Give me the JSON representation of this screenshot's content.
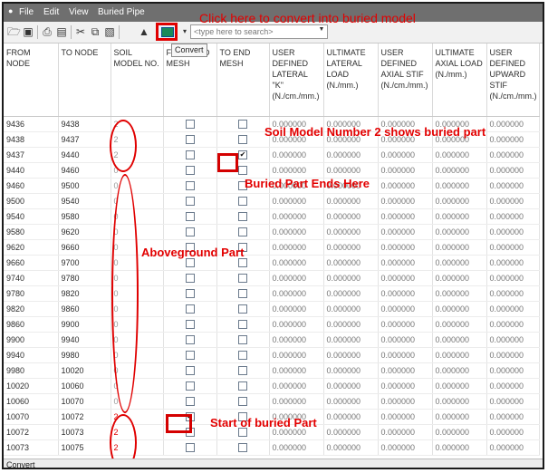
{
  "menu": {
    "items": [
      "File",
      "Edit",
      "View",
      "Buried Pipe"
    ]
  },
  "toolbar": {
    "icons": [
      "folder-open-icon",
      "save-icon",
      "print-icon",
      "print-preview-icon",
      "cut-icon",
      "copy-icon",
      "paste-icon",
      "tree-icon",
      "convert-icon"
    ],
    "search_placeholder": "<type here to search>",
    "tooltip": "Convert"
  },
  "annotations": {
    "top": "Click here to convert into buried model",
    "soil_model": "Soil Model Number 2 shows buried part",
    "buried_end": "Buried Part Ends Here",
    "aboveground": "Aboveground Part",
    "buried_start": "Start of buried Part"
  },
  "table": {
    "headers": [
      "FROM NODE",
      "TO NODE",
      "SOIL MODEL NO.",
      "FROM END MESH",
      "TO END MESH",
      "USER DEFINED LATERAL \"K\" (N./cm./mm.)",
      "ULTIMATE LATERAL LOAD (N./mm.)",
      "USER DEFINED AXIAL STIF (N./cm./mm.)",
      "ULTIMATE AXIAL LOAD (N./mm.)",
      "USER DEFINED UPWARD STIF (N./cm./mm.)"
    ],
    "rows": [
      {
        "from": "9436",
        "to": "9438",
        "soil": "2",
        "from_mesh": false,
        "to_mesh": false,
        "v": [
          "0.000000",
          "0.000000",
          "0.000000",
          "0.000000",
          "0.000000"
        ]
      },
      {
        "from": "9438",
        "to": "9437",
        "soil": "2",
        "from_mesh": false,
        "to_mesh": false,
        "v": [
          "0.000000",
          "0.000000",
          "0.000000",
          "0.000000",
          "0.000000"
        ]
      },
      {
        "from": "9437",
        "to": "9440",
        "soil": "2",
        "from_mesh": false,
        "to_mesh": true,
        "v": [
          "0.000000",
          "0.000000",
          "0.000000",
          "0.000000",
          "0.000000"
        ]
      },
      {
        "from": "9440",
        "to": "9460",
        "soil": "0",
        "from_mesh": false,
        "to_mesh": false,
        "v": [
          "0.000000",
          "0.000000",
          "0.000000",
          "0.000000",
          "0.000000"
        ]
      },
      {
        "from": "9460",
        "to": "9500",
        "soil": "0",
        "from_mesh": false,
        "to_mesh": false,
        "v": [
          "0.000000",
          "0.000000",
          "0.000000",
          "0.000000",
          "0.000000"
        ]
      },
      {
        "from": "9500",
        "to": "9540",
        "soil": "0",
        "from_mesh": false,
        "to_mesh": false,
        "v": [
          "0.000000",
          "0.000000",
          "0.000000",
          "0.000000",
          "0.000000"
        ]
      },
      {
        "from": "9540",
        "to": "9580",
        "soil": "0",
        "from_mesh": false,
        "to_mesh": false,
        "v": [
          "0.000000",
          "0.000000",
          "0.000000",
          "0.000000",
          "0.000000"
        ]
      },
      {
        "from": "9580",
        "to": "9620",
        "soil": "0",
        "from_mesh": false,
        "to_mesh": false,
        "v": [
          "0.000000",
          "0.000000",
          "0.000000",
          "0.000000",
          "0.000000"
        ]
      },
      {
        "from": "9620",
        "to": "9660",
        "soil": "0",
        "from_mesh": false,
        "to_mesh": false,
        "v": [
          "0.000000",
          "0.000000",
          "0.000000",
          "0.000000",
          "0.000000"
        ]
      },
      {
        "from": "9660",
        "to": "9700",
        "soil": "0",
        "from_mesh": false,
        "to_mesh": false,
        "v": [
          "0.000000",
          "0.000000",
          "0.000000",
          "0.000000",
          "0.000000"
        ]
      },
      {
        "from": "9740",
        "to": "9780",
        "soil": "0",
        "from_mesh": false,
        "to_mesh": false,
        "v": [
          "0.000000",
          "0.000000",
          "0.000000",
          "0.000000",
          "0.000000"
        ]
      },
      {
        "from": "9780",
        "to": "9820",
        "soil": "0",
        "from_mesh": false,
        "to_mesh": false,
        "v": [
          "0.000000",
          "0.000000",
          "0.000000",
          "0.000000",
          "0.000000"
        ]
      },
      {
        "from": "9820",
        "to": "9860",
        "soil": "0",
        "from_mesh": false,
        "to_mesh": false,
        "v": [
          "0.000000",
          "0.000000",
          "0.000000",
          "0.000000",
          "0.000000"
        ]
      },
      {
        "from": "9860",
        "to": "9900",
        "soil": "0",
        "from_mesh": false,
        "to_mesh": false,
        "v": [
          "0.000000",
          "0.000000",
          "0.000000",
          "0.000000",
          "0.000000"
        ]
      },
      {
        "from": "9900",
        "to": "9940",
        "soil": "0",
        "from_mesh": false,
        "to_mesh": false,
        "v": [
          "0.000000",
          "0.000000",
          "0.000000",
          "0.000000",
          "0.000000"
        ]
      },
      {
        "from": "9940",
        "to": "9980",
        "soil": "0",
        "from_mesh": false,
        "to_mesh": false,
        "v": [
          "0.000000",
          "0.000000",
          "0.000000",
          "0.000000",
          "0.000000"
        ]
      },
      {
        "from": "9980",
        "to": "10020",
        "soil": "0",
        "from_mesh": false,
        "to_mesh": false,
        "v": [
          "0.000000",
          "0.000000",
          "0.000000",
          "0.000000",
          "0.000000"
        ]
      },
      {
        "from": "10020",
        "to": "10060",
        "soil": "0",
        "from_mesh": false,
        "to_mesh": false,
        "v": [
          "0.000000",
          "0.000000",
          "0.000000",
          "0.000000",
          "0.000000"
        ]
      },
      {
        "from": "10060",
        "to": "10070",
        "soil": "0",
        "from_mesh": false,
        "to_mesh": false,
        "v": [
          "0.000000",
          "0.000000",
          "0.000000",
          "0.000000",
          "0.000000"
        ]
      },
      {
        "from": "10070",
        "to": "10072",
        "soil": "2",
        "from_mesh": true,
        "to_mesh": false,
        "v": [
          "0.000000",
          "0.000000",
          "0.000000",
          "0.000000",
          "0.000000"
        ]
      },
      {
        "from": "10072",
        "to": "10073",
        "soil": "2",
        "from_mesh": false,
        "to_mesh": false,
        "v": [
          "0.000000",
          "0.000000",
          "0.000000",
          "0.000000",
          "0.000000"
        ]
      },
      {
        "from": "10073",
        "to": "10075",
        "soil": "2",
        "from_mesh": false,
        "to_mesh": false,
        "v": [
          "0.000000",
          "0.000000",
          "0.000000",
          "0.000000",
          "0.000000"
        ]
      }
    ]
  },
  "status": {
    "text": "Convert"
  },
  "colors": {
    "annotation": "#e30000",
    "menubar": "#6f6f6f"
  }
}
